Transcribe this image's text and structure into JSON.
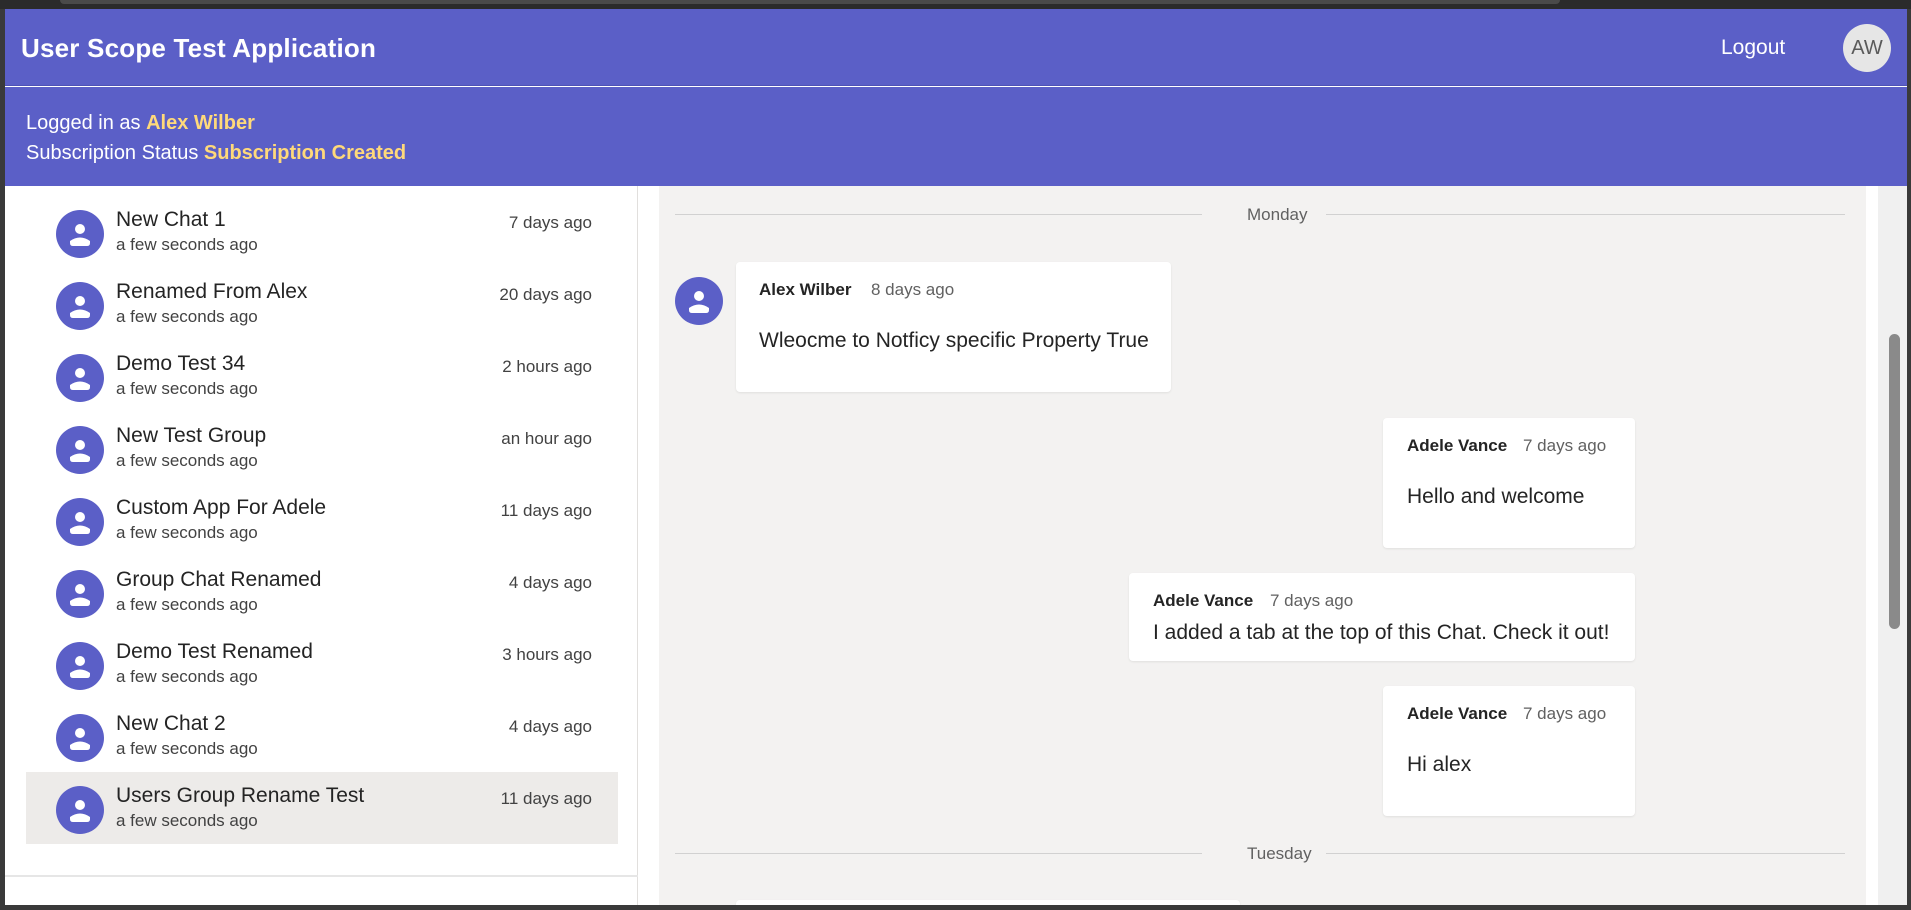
{
  "app": {
    "title": "User Scope Test Application",
    "logout_label": "Logout",
    "user_initials": "AW",
    "accent": "#5b5fc7",
    "highlight": "#ffd97a"
  },
  "info": {
    "logged_in_prefix": "Logged in as",
    "logged_in_user": "Alex Wilber",
    "subscription_prefix": "Subscription Status",
    "subscription_status": "Subscription Created"
  },
  "chats": [
    {
      "name": "New Chat 1",
      "subtitle": "a few seconds ago",
      "time": "7 days ago"
    },
    {
      "name": "Renamed From Alex",
      "subtitle": "a few seconds ago",
      "time": "20 days ago"
    },
    {
      "name": "Demo Test 34",
      "subtitle": "a few seconds ago",
      "time": "2 hours ago"
    },
    {
      "name": "New Test Group",
      "subtitle": "a few seconds ago",
      "time": "an hour ago"
    },
    {
      "name": "Custom App For Adele",
      "subtitle": "a few seconds ago",
      "time": "11 days ago"
    },
    {
      "name": "Group Chat Renamed",
      "subtitle": "a few seconds ago",
      "time": "4 days ago"
    },
    {
      "name": "Demo Test Renamed",
      "subtitle": "a few seconds ago",
      "time": "3 hours ago"
    },
    {
      "name": "New Chat 2",
      "subtitle": "a few seconds ago",
      "time": "4 days ago"
    },
    {
      "name": "Users Group Rename Test",
      "subtitle": "a few seconds ago",
      "time": "11 days ago"
    }
  ],
  "conversation": {
    "days": [
      "Monday",
      "Tuesday"
    ],
    "messages": [
      {
        "author": "Alex Wilber",
        "time": "8 days ago",
        "text": "Wleocme to Notficy specific Property True"
      },
      {
        "author": "Adele Vance",
        "time": "7 days ago",
        "text": "Hello and welcome"
      },
      {
        "author": "Adele Vance",
        "time": "7 days ago",
        "text": "I added a tab at the top of this Chat. Check it out!"
      },
      {
        "author": "Adele Vance",
        "time": "7 days ago",
        "text": "Hi alex"
      }
    ]
  }
}
